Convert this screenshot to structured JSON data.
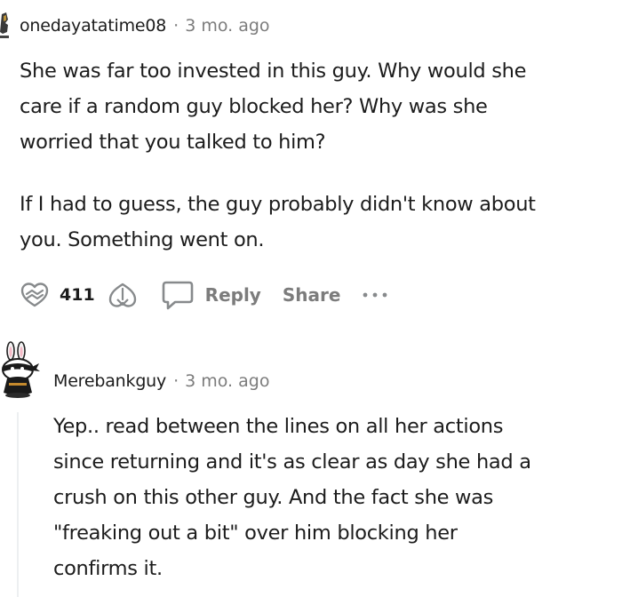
{
  "comments": [
    {
      "username": "onedayatatime08",
      "separator": "·",
      "time": "3 mo. ago",
      "paragraphs": [
        [
          "She was far too invested in this guy. Why would she",
          "care if a random guy blocked her? Why was she",
          "worried that you talked to him?"
        ],
        [
          "If I had to guess, the guy probably didn't know about",
          "you. Something went on."
        ]
      ],
      "actions": {
        "vote_count": "411",
        "reply_label": "Reply",
        "share_label": "Share",
        "more_label": "···"
      },
      "icons": {
        "avatar": "avatar-icon",
        "upvote": "upvote-icon",
        "downvote": "downvote-icon",
        "reply": "comment-bubble-icon",
        "more": "ellipsis-icon"
      }
    },
    {
      "username": "Merebankguy",
      "separator": "·",
      "time": "3 mo. ago",
      "paragraphs": [
        [
          "Yep.. read between the lines on all her actions",
          "since returning and it's as clear as day she had a",
          "crush on this other guy. And the fact she was",
          "\"freaking out a bit\" over him blocking her",
          "confirms it."
        ]
      ],
      "icons": {
        "avatar": "snoo-avatar-icon"
      }
    }
  ],
  "colors": {
    "text": "#1c1c1c",
    "meta": "#7c7c7c",
    "thread_line": "#edeff1"
  }
}
